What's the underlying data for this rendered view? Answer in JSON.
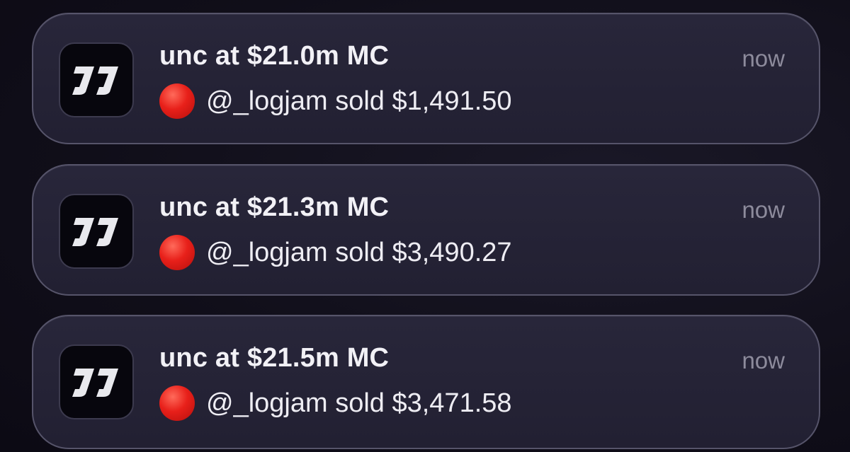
{
  "notifications": [
    {
      "app_icon": "jj-logo-icon",
      "title": "unc at $21.0m MC",
      "time": "now",
      "status_icon": "red-circle-icon",
      "body": "@_logjam sold $1,491.50"
    },
    {
      "app_icon": "jj-logo-icon",
      "title": "unc at $21.3m MC",
      "time": "now",
      "status_icon": "red-circle-icon",
      "body": "@_logjam sold $3,490.27"
    },
    {
      "app_icon": "jj-logo-icon",
      "title": "unc at $21.5m MC",
      "time": "now",
      "status_icon": "red-circle-icon",
      "body": "@_logjam sold $3,471.58"
    }
  ],
  "colors": {
    "background": "#0f0d18",
    "card": "#262437",
    "card_border": "#56546a",
    "title": "#f2f1f6",
    "time": "#8d8b9c",
    "sell_dot": "#e8201a"
  }
}
